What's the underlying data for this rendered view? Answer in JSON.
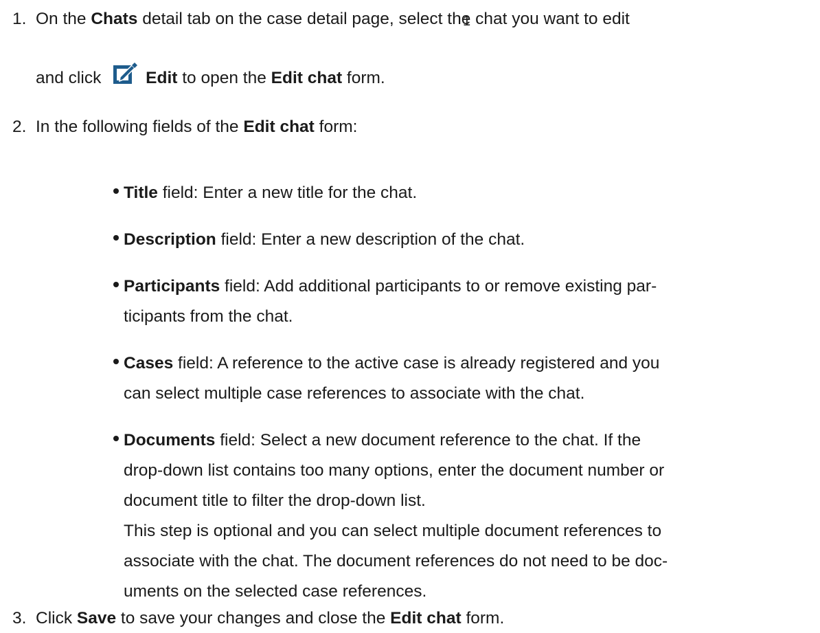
{
  "steps": [
    {
      "number": "1.",
      "p1": "On the ",
      "b1": "Chats",
      "p2": " detail tab on the case detail page, select the chat you want to edit",
      "p3": "and click ",
      "b2": "Edit",
      "p4": " to open the ",
      "b3": "Edit chat",
      "p5": " form.",
      "footnote_mark": "1",
      "icon": "edit-icon"
    },
    {
      "number": "2.",
      "p1": "In the following fields of the ",
      "b1": "Edit chat",
      "p2": " form:",
      "fields": [
        {
          "name": "Title",
          "rest_lines": [
            " field: Enter a new title for the chat."
          ]
        },
        {
          "name": "Description",
          "rest_lines": [
            " field: Enter a new description of the chat."
          ]
        },
        {
          "name": "Participants",
          "rest_lines": [
            " field: Add additional participants to or remove existing par-",
            "ticipants from the chat."
          ]
        },
        {
          "name": "Cases",
          "rest_lines": [
            " field: A reference to the active case is already registered and you",
            "can select multiple case references to associate with the chat."
          ]
        },
        {
          "name": "Documents",
          "rest_lines": [
            " field: Select a new document reference to the chat. If the",
            "drop-down list contains too many options, enter the document number or",
            "document title to filter the drop-down list.",
            "This step is optional and you can select multiple document references to",
            "associate with the chat. The document references do not need to be doc-",
            "uments on the selected case references."
          ]
        }
      ]
    },
    {
      "number": "3.",
      "p1": "Click ",
      "b1": "Save",
      "p2": " to save your changes and close the ",
      "b2": "Edit chat",
      "p3": " form."
    }
  ]
}
